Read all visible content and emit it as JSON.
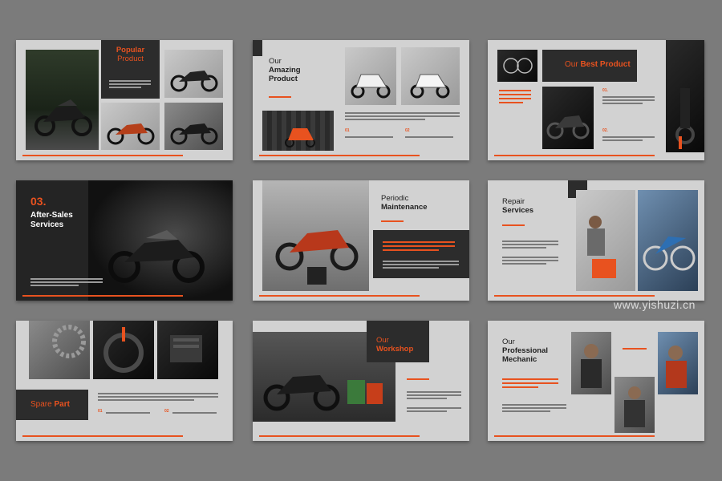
{
  "watermark": "www.yishuzi.cn",
  "colors": {
    "background": "#7b7b7b",
    "slide": "#d2d2d2",
    "dark": "#2c2c2c",
    "accent": "#e8521f"
  },
  "slides": [
    {
      "title_line1": "Popular",
      "title_line2": "Product"
    },
    {
      "title_line1": "Our",
      "title_line2": "Amazing",
      "title_line3": "Product",
      "num1": "01",
      "num2": "02"
    },
    {
      "title_normal": "Our ",
      "title_bold": "Best Product",
      "num1": "01.",
      "num2": "02."
    },
    {
      "num": "03.",
      "title_line1": "After-Sales",
      "title_line2": "Services"
    },
    {
      "title_line1": "Periodic",
      "title_line2": "Maintenance"
    },
    {
      "title_line1": "Repair",
      "title_line2": "Services"
    },
    {
      "title_normal": "Spare ",
      "title_bold": "Part",
      "num1": "01",
      "num2": "02"
    },
    {
      "title_line1": "Our",
      "title_line2": "Workshop"
    },
    {
      "title_line1": "Our",
      "title_line2": "Professional",
      "title_line3": "Mechanic"
    }
  ]
}
